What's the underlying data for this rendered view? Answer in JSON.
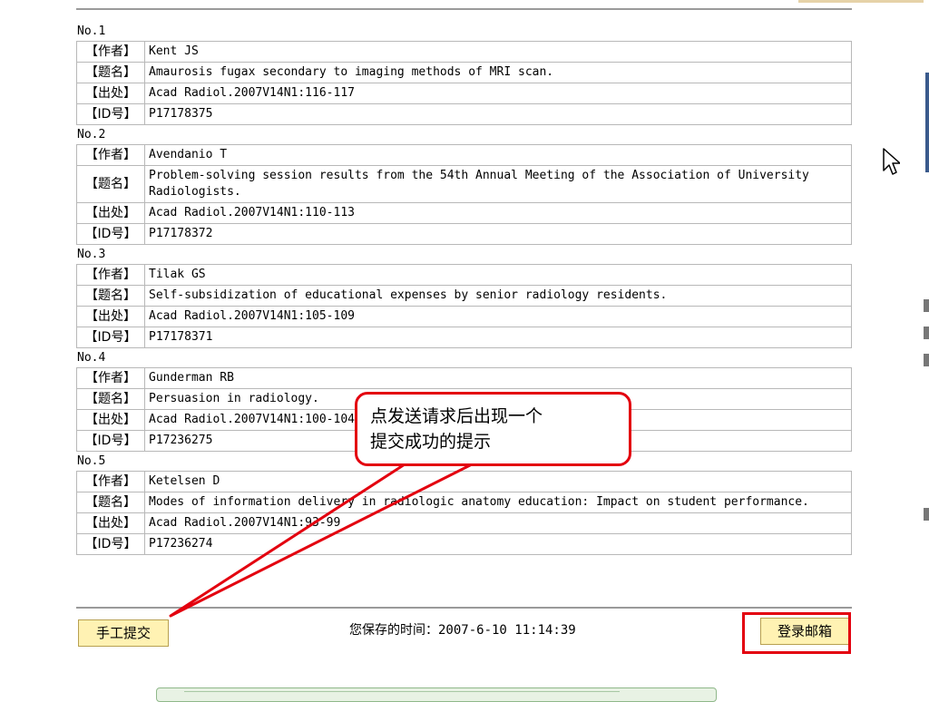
{
  "records": [
    {
      "no": "No.1",
      "author_label": "【作者】",
      "author": "Kent JS",
      "title_label": "【题名】",
      "title": "Amaurosis fugax secondary to imaging methods of MRI scan.",
      "source_label": "【出处】",
      "source": "Acad Radiol.2007V14N1:116-117",
      "id_label": "【ID号】",
      "id": "P17178375"
    },
    {
      "no": "No.2",
      "author_label": "【作者】",
      "author": "Avendanio T",
      "title_label": "【题名】",
      "title": "Problem-solving session results from the 54th Annual Meeting of the Association of University Radiologists.",
      "source_label": "【出处】",
      "source": "Acad Radiol.2007V14N1:110-113",
      "id_label": "【ID号】",
      "id": "P17178372"
    },
    {
      "no": "No.3",
      "author_label": "【作者】",
      "author": "Tilak GS",
      "title_label": "【题名】",
      "title": "Self-subsidization of educational expenses by senior radiology residents.",
      "source_label": "【出处】",
      "source": "Acad Radiol.2007V14N1:105-109",
      "id_label": "【ID号】",
      "id": "P17178371"
    },
    {
      "no": "No.4",
      "author_label": "【作者】",
      "author": "Gunderman RB",
      "title_label": "【题名】",
      "title": "Persuasion in radiology.",
      "source_label": "【出处】",
      "source": "Acad Radiol.2007V14N1:100-104",
      "id_label": "【ID号】",
      "id": "P17236275"
    },
    {
      "no": "No.5",
      "author_label": "【作者】",
      "author": "Ketelsen D",
      "title_label": "【题名】",
      "title": "Modes of information delivery in radiologic anatomy education: Impact on student performance.",
      "source_label": "【出处】",
      "source": "Acad Radiol.2007V14N1:93-99",
      "id_label": "【ID号】",
      "id": "P17236274"
    }
  ],
  "footer": {
    "manual_submit": "手工提交",
    "save_time_label": "您保存的时间：",
    "save_time_value": "2007-6-10 11:14:39",
    "login_mailbox": "登录邮箱"
  },
  "callout": {
    "line1": "点发送请求后出现一个",
    "line2": "提交成功的提示"
  },
  "icons": {
    "cursor": "mouse-pointer-icon"
  },
  "colors": {
    "button_bg": "#fff2b3",
    "highlight_red": "#e3000f"
  }
}
